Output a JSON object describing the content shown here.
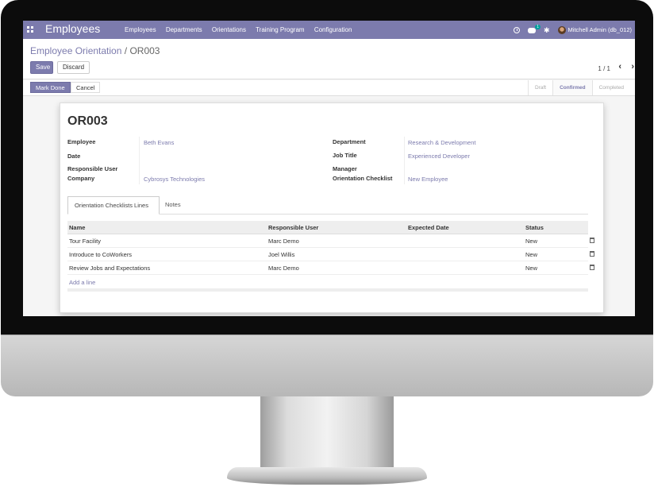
{
  "navbar": {
    "app_title": "Employees",
    "menu": [
      "Employees",
      "Departments",
      "Orientations",
      "Training Program",
      "Configuration"
    ],
    "chat_badge": "1",
    "user": "Mitchell Admin (db_012)"
  },
  "breadcrumb": {
    "parent": "Employee Orientation",
    "separator": "/",
    "current": "OR003"
  },
  "actions": {
    "save": "Save",
    "discard": "Discard"
  },
  "pager": {
    "text": "1 / 1",
    "prev": "‹",
    "next": "›"
  },
  "statusbar": {
    "mark_done": "Mark Done",
    "cancel": "Cancel",
    "stages": [
      "Draft",
      "Confirmed",
      "Completed"
    ],
    "active_stage": "Confirmed"
  },
  "form": {
    "name": "OR003",
    "left": [
      {
        "label": "Employee",
        "value": "Beth Evans"
      },
      {
        "label": "Date",
        "value": ""
      },
      {
        "label": "Responsible User",
        "value": ""
      },
      {
        "label": "Company",
        "value": "Cybrosys Technologies"
      }
    ],
    "right": [
      {
        "label": "Department",
        "value": "Research & Development"
      },
      {
        "label": "Job Title",
        "value": "Experienced Developer"
      },
      {
        "label": "Manager",
        "value": ""
      },
      {
        "label": "Orientation Checklist",
        "value": "New Employee"
      }
    ]
  },
  "tabs": [
    "Orientation Checklists Lines",
    "Notes"
  ],
  "table": {
    "headers": [
      "Name",
      "Responsible User",
      "Expected Date",
      "Status"
    ],
    "rows": [
      [
        "Tour Facility",
        "Marc Demo",
        "",
        "New"
      ],
      [
        "Introduce to CoWorkers",
        "Joel Willis",
        "",
        "New"
      ],
      [
        "Review Jobs and Expectations",
        "Marc Demo",
        "",
        "New"
      ]
    ],
    "add_line": "Add a line"
  },
  "colors": {
    "brand": "#7c7bad",
    "accent": "#00a09d"
  }
}
